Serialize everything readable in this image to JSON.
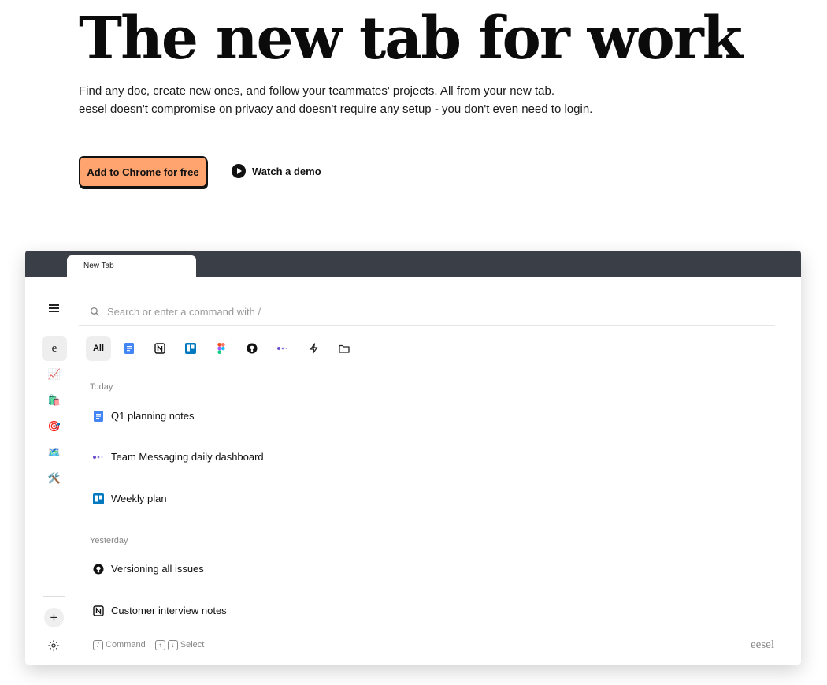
{
  "hero": {
    "title": "The new tab for work",
    "subtitle_line1": "Find any doc, create new ones, and follow your teammates' projects. All from your new tab.",
    "subtitle_line2": "eesel doesn't compromise on privacy and doesn't require any setup - you don't even need to login.",
    "cta_label": "Add to Chrome for free",
    "cta_color": "#ffa46f",
    "demo_label": "Watch a demo"
  },
  "browser": {
    "tab_title": "New Tab",
    "tab_strip_color": "#3a3e46"
  },
  "sidebar": {
    "items": [
      {
        "label": "e",
        "icon": "eesel-logo-icon"
      },
      {
        "label": "📈",
        "icon": "chart-emoji-icon"
      },
      {
        "label": "🛍️",
        "icon": "shopping-bags-emoji-icon"
      },
      {
        "label": "🎯",
        "icon": "target-emoji-icon"
      },
      {
        "label": "🗺️",
        "icon": "map-emoji-icon"
      },
      {
        "label": "🛠️",
        "icon": "tools-emoji-icon"
      }
    ],
    "add_label": "+"
  },
  "search": {
    "placeholder": "Search or enter a command with /"
  },
  "filters": [
    {
      "label": "All",
      "icon": "all-filter"
    },
    {
      "icon": "google-docs-icon"
    },
    {
      "icon": "notion-icon"
    },
    {
      "icon": "trello-icon"
    },
    {
      "icon": "figma-icon"
    },
    {
      "icon": "github-icon"
    },
    {
      "icon": "messaging-icon"
    },
    {
      "icon": "lightning-icon"
    },
    {
      "icon": "folder-icon"
    }
  ],
  "results": {
    "today_label": "Today",
    "today": [
      {
        "title": "Q1 planning notes",
        "icon": "google-docs-icon"
      },
      {
        "title": "Team Messaging daily dashboard",
        "icon": "messaging-icon"
      },
      {
        "title": "Weekly plan",
        "icon": "trello-icon"
      }
    ],
    "yesterday_label": "Yesterday",
    "yesterday": [
      {
        "title": "Versioning all issues",
        "icon": "github-icon"
      },
      {
        "title": "Customer interview notes",
        "icon": "notion-icon"
      }
    ]
  },
  "footer": {
    "command_key": "/",
    "command_label": "Command",
    "up_key": "↑",
    "down_key": "↓",
    "select_label": "Select",
    "brand": "eesel"
  },
  "colors": {
    "docs_blue": "#4285f4",
    "trello_blue": "#0079bf",
    "messaging_purple": "#6b4fcf"
  }
}
